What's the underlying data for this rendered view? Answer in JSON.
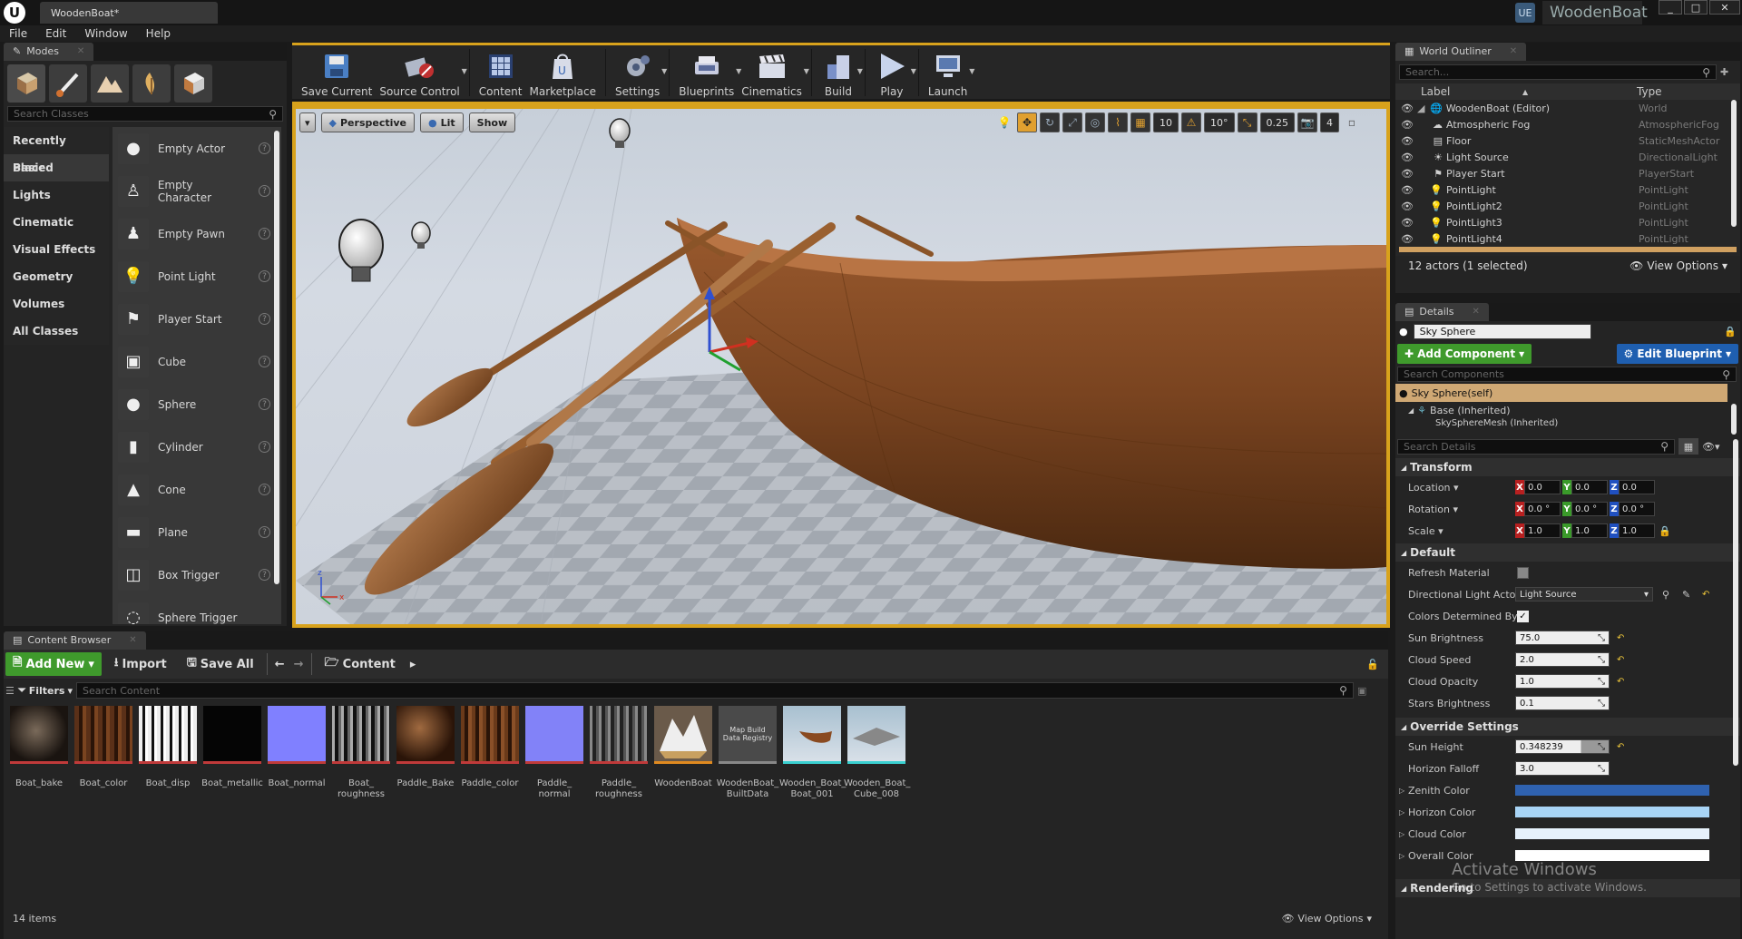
{
  "app": {
    "tab_title": "WoodenBoat*",
    "project_badge": "UE",
    "project_name": "WoodenBoat"
  },
  "window_buttons": {
    "minimize": "_",
    "maximize": "□",
    "close": "✕"
  },
  "menu": [
    "File",
    "Edit",
    "Window",
    "Help"
  ],
  "modes": {
    "tab": "Modes",
    "search_placeholder": "Search Classes",
    "categories": [
      "Recently Placed",
      "Basic",
      "Lights",
      "Cinematic",
      "Visual Effects",
      "Geometry",
      "Volumes",
      "All Classes"
    ],
    "selected_category": "Basic",
    "actors": [
      "Empty Actor",
      "Empty Character",
      "Empty Pawn",
      "Point Light",
      "Player Start",
      "Cube",
      "Sphere",
      "Cylinder",
      "Cone",
      "Plane",
      "Box Trigger"
    ],
    "partial_actor": "Sphere Trigger"
  },
  "toolbar": {
    "buttons": [
      "Save Current",
      "Source Control",
      "Content",
      "Marketplace",
      "Settings",
      "Blueprints",
      "Cinematics",
      "Build",
      "Play",
      "Launch"
    ]
  },
  "viewport": {
    "view_mode": "Perspective",
    "lighting": "Lit",
    "show": "Show",
    "grid_snap": "10",
    "rotation_snap": "10°",
    "scale_snap": "0.25",
    "camera_speed": "4"
  },
  "content_browser": {
    "tab": "Content Browser",
    "add_new": "Add New",
    "import": "Import",
    "save_all": "Save All",
    "path": "Content",
    "filters": "Filters",
    "search_placeholder": "Search Content",
    "item_count": "14 items",
    "view_options": "View Options",
    "assets": [
      {
        "name": "Boat_bake"
      },
      {
        "name": "Boat_color"
      },
      {
        "name": "Boat_disp"
      },
      {
        "name": "Boat_metallic"
      },
      {
        "name": "Boat_normal"
      },
      {
        "name": "Boat_ roughness"
      },
      {
        "name": "Paddle_Bake"
      },
      {
        "name": "Paddle_color"
      },
      {
        "name": "Paddle_ normal"
      },
      {
        "name": "Paddle_ roughness"
      },
      {
        "name": "WoodenBoat"
      },
      {
        "name": "WoodenBoat_ BuiltData",
        "thumb_text": "Map Build Data Registry"
      },
      {
        "name": "Wooden_Boat_ Boat_001"
      },
      {
        "name": "Wooden_Boat_ Cube_008"
      }
    ]
  },
  "outliner": {
    "tab": "World Outliner",
    "search_placeholder": "Search...",
    "col_label": "Label",
    "col_type": "Type",
    "rows": [
      {
        "label": "WoodenBoat (Editor)",
        "type": "World"
      },
      {
        "label": "Atmospheric Fog",
        "type": "AtmosphericFog"
      },
      {
        "label": "Floor",
        "type": "StaticMeshActor"
      },
      {
        "label": "Light Source",
        "type": "DirectionalLight"
      },
      {
        "label": "Player Start",
        "type": "PlayerStart"
      },
      {
        "label": "PointLight",
        "type": "PointLight"
      },
      {
        "label": "PointLight2",
        "type": "PointLight"
      },
      {
        "label": "PointLight3",
        "type": "PointLight"
      },
      {
        "label": "PointLight4",
        "type": "PointLight"
      }
    ],
    "status": "12 actors (1 selected)",
    "view_options": "View Options"
  },
  "details": {
    "tab": "Details",
    "object_name": "Sky Sphere",
    "add_component": "Add Component",
    "edit_blueprint": "Edit Blueprint",
    "search_components": "Search Components",
    "self_component": "Sky Sphere(self)",
    "base": "Base (Inherited)",
    "mesh": "SkySphereMesh (Inherited)",
    "search_details": "Search Details",
    "transform": {
      "title": "Transform",
      "location_label": "Location",
      "rotation_label": "Rotation",
      "scale_label": "Scale",
      "location": [
        "0.0",
        "0.0",
        "0.0"
      ],
      "rotation": [
        "0.0 °",
        "0.0 °",
        "0.0 °"
      ],
      "scale": [
        "1.0",
        "1.0",
        "1.0"
      ]
    },
    "default": {
      "title": "Default",
      "refresh_material": "Refresh Material",
      "directional_light_actor": "Directional Light Actor",
      "directional_light_value": "Light Source",
      "colors_determined_by": "Colors Determined By",
      "sun_brightness": "Sun Brightness",
      "sun_brightness_value": "75.0",
      "cloud_speed": "Cloud Speed",
      "cloud_speed_value": "2.0",
      "cloud_opacity": "Cloud Opacity",
      "cloud_opacity_value": "1.0",
      "stars_brightness": "Stars Brightness",
      "stars_brightness_value": "0.1"
    },
    "override": {
      "title": "Override Settings",
      "sun_height": "Sun Height",
      "sun_height_value": "0.348239",
      "horizon_falloff": "Horizon Falloff",
      "horizon_falloff_value": "3.0",
      "zenith_color": "Zenith Color",
      "horizon_color": "Horizon Color",
      "cloud_color": "Cloud Color",
      "overall_color": "Overall Color"
    },
    "rendering": "Rendering",
    "colors": {
      "zenith": "#2f62b0",
      "horizon": "#a8d4f5",
      "cloud": "#e6f1fb",
      "overall": "#ffffff"
    }
  },
  "watermark": {
    "line1": "Activate Windows",
    "line2": "Go to Settings to activate Windows."
  }
}
